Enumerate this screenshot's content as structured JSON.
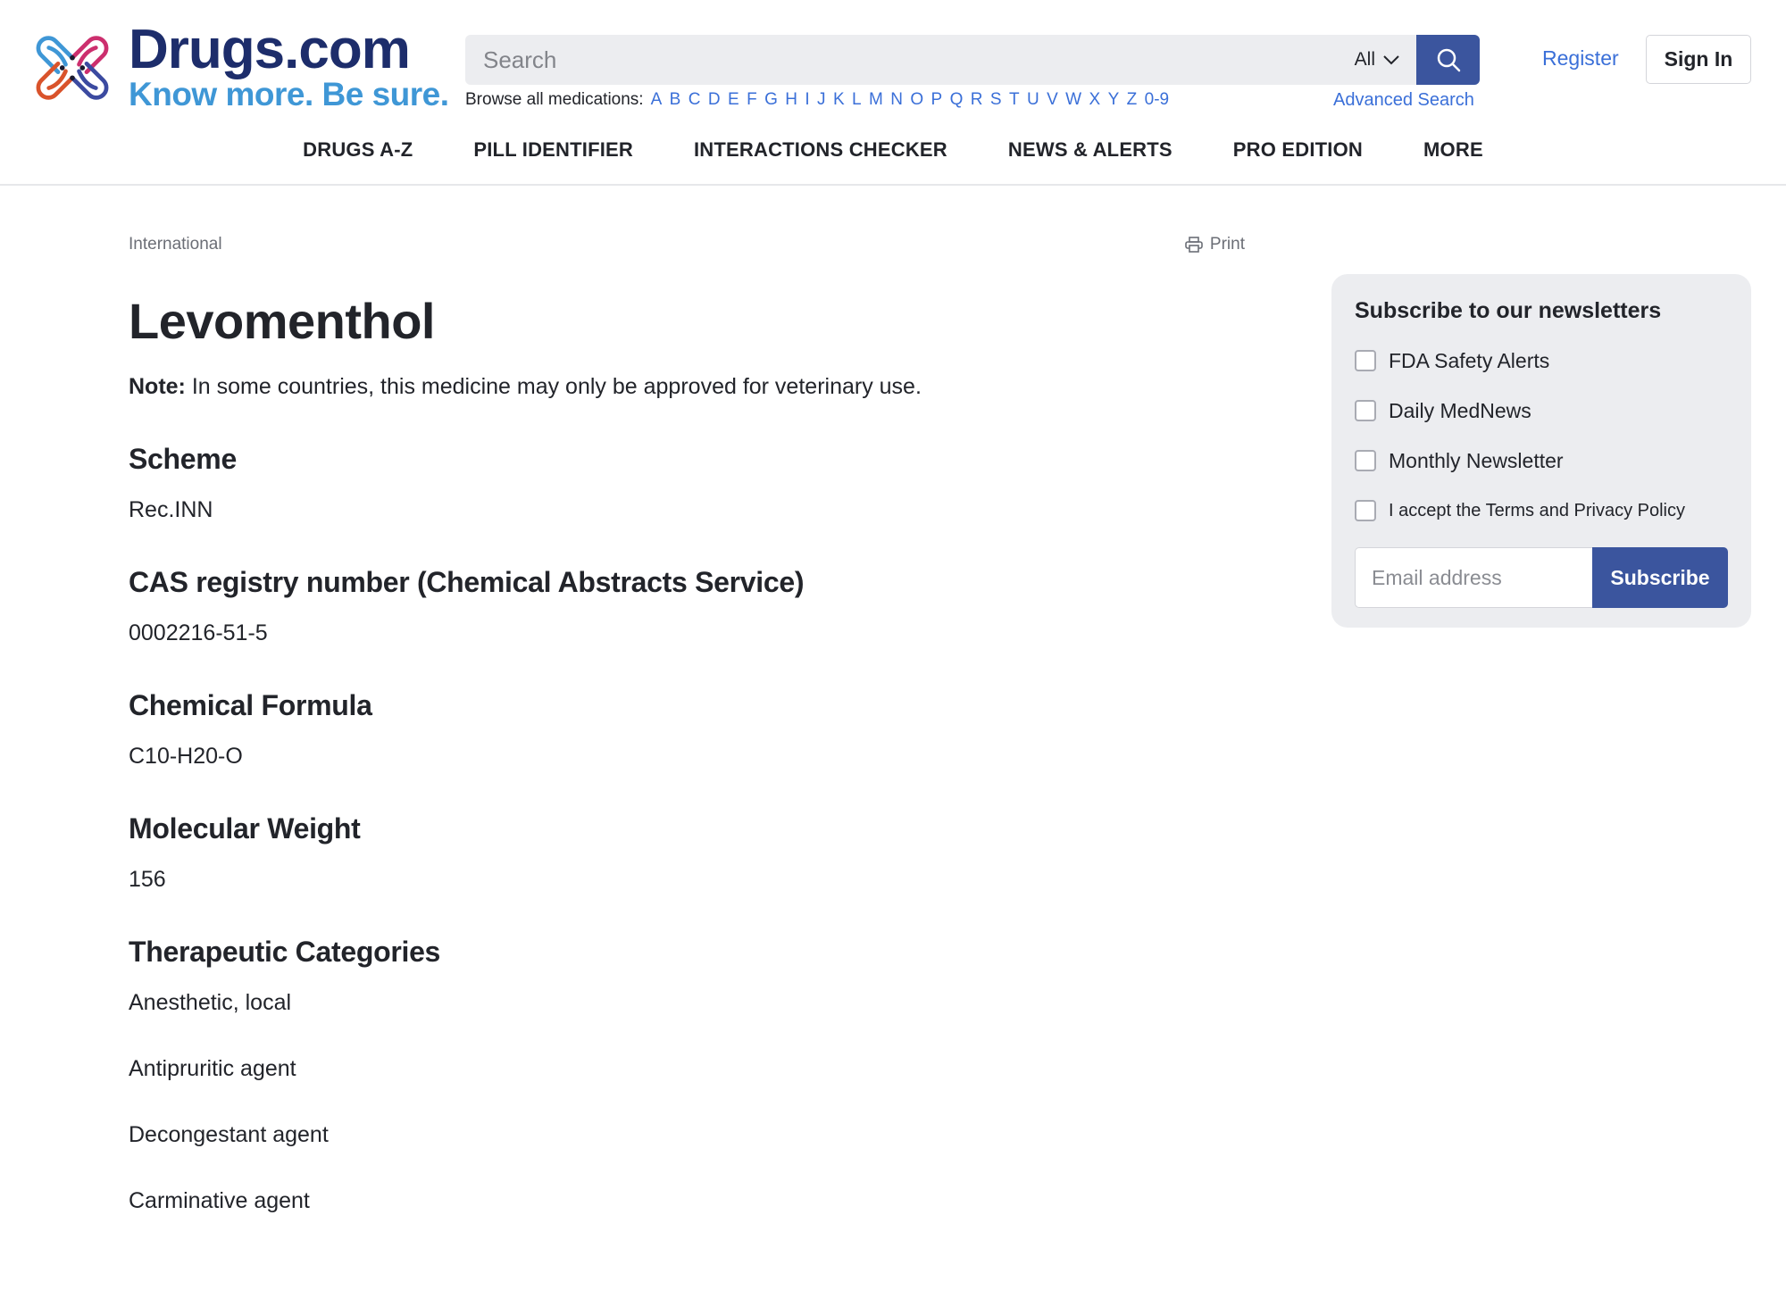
{
  "header": {
    "logo": {
      "title": "Drugs.com",
      "tagline": "Know more. Be sure."
    },
    "search": {
      "placeholder": "Search",
      "scope": "All",
      "scope_icon": "chevron-down-icon",
      "button_icon": "search-icon"
    },
    "browse": {
      "label": "Browse all medications:",
      "letters": [
        "A",
        "B",
        "C",
        "D",
        "E",
        "F",
        "G",
        "H",
        "I",
        "J",
        "K",
        "L",
        "M",
        "N",
        "O",
        "P",
        "Q",
        "R",
        "S",
        "T",
        "U",
        "V",
        "W",
        "X",
        "Y",
        "Z",
        "0-9"
      ]
    },
    "advanced_search": "Advanced Search",
    "register": "Register",
    "sign_in": "Sign In"
  },
  "nav": {
    "items": [
      {
        "label": "DRUGS A-Z"
      },
      {
        "label": "PILL IDENTIFIER"
      },
      {
        "label": "INTERACTIONS CHECKER"
      },
      {
        "label": "NEWS & ALERTS"
      },
      {
        "label": "PRO EDITION"
      },
      {
        "label": "MORE"
      }
    ]
  },
  "main": {
    "breadcrumb": "International",
    "print_label": "Print",
    "title": "Levomenthol",
    "note_label": "Note:",
    "note_text": " In some countries, this medicine may only be approved for veterinary use.",
    "sections": [
      {
        "heading": "Scheme",
        "value": "Rec.INN"
      },
      {
        "heading": "CAS registry number (Chemical Abstracts Service)",
        "value": "0002216-51-5"
      },
      {
        "heading": "Chemical Formula",
        "value": "C10-H20-O"
      },
      {
        "heading": "Molecular Weight",
        "value": "156"
      }
    ],
    "therapeutic": {
      "heading": "Therapeutic Categories",
      "items": [
        "Anesthetic, local",
        "Antipruritic agent",
        "Decongestant agent",
        "Carminative agent"
      ]
    }
  },
  "newsletter": {
    "title": "Subscribe to our newsletters",
    "options": [
      {
        "label": "FDA Safety Alerts",
        "checked": false
      },
      {
        "label": "Daily MedNews",
        "checked": false
      },
      {
        "label": "Monthly Newsletter",
        "checked": false
      },
      {
        "label": "I accept the Terms and Privacy Policy",
        "checked": false
      }
    ],
    "email_placeholder": "Email address",
    "subscribe_label": "Subscribe"
  },
  "colors": {
    "brand_navy": "#1d2d6b",
    "brand_blue": "#3f97d6",
    "link": "#3a6fd8",
    "button": "#3b559e",
    "panel_bg": "#ecedf0"
  }
}
